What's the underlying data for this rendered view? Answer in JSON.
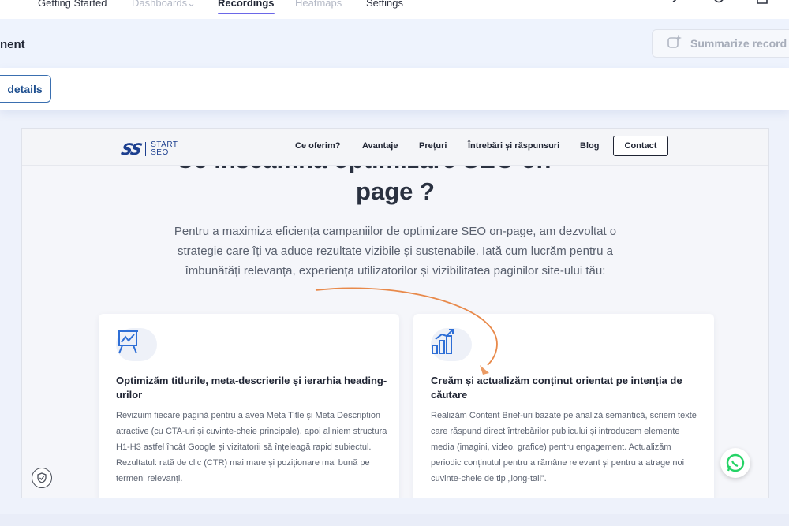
{
  "app_nav": {
    "tabs": [
      {
        "label": "Getting Started"
      },
      {
        "label": "Dashboards"
      },
      {
        "label": "Recordings"
      },
      {
        "label": "Heatmaps"
      },
      {
        "label": "Settings"
      }
    ],
    "chevron": "⌄",
    "icons": [
      "help-icon",
      "notification-icon",
      "calendar-icon"
    ]
  },
  "session": {
    "title_fragment": "nent",
    "summarize_label": "Summarize record",
    "details_label": "details"
  },
  "site": {
    "logo_mark": "SS",
    "logo_word_1": "START",
    "logo_word_2": "SEO",
    "nav": [
      "Ce oferim?",
      "Avantaje",
      "Prețuri",
      "Întrebări și răspunsuri",
      "Blog"
    ],
    "contact_label": "Contact",
    "heading_cut": "Ce înseamnă optimizare SEO on",
    "heading_line2": "page ?",
    "intro": "Pentru a maximiza eficiența campaniilor de optimizare SEO on-page, am dezvoltat o strategie care îți va aduce rezultate vizibile și sustenabile. Iată cum lucrăm pentru a îmbunătăți relevanța, experiența utilizatorilor și vizibilitatea paginilor site-ului tău:",
    "cards": [
      {
        "icon": "presentation-chart-icon",
        "title": "Optimizăm titlurile, meta-descrierile și ierarhia heading-urilor",
        "body": "Revizuim fiecare pagină pentru a avea Meta Title și Meta Description atractive (cu CTA-uri și cuvinte-cheie principale), apoi aliniem structura H1-H3 astfel încât Google și vizitatorii să înțeleagă rapid subiectul. Rezultatul: rată de clic (CTR) mai mare și poziționare mai bună pe termeni relevanți."
      },
      {
        "icon": "bar-growth-icon",
        "title": "Creăm și actualizăm conținut orientat pe intenția de căutare",
        "body": "Realizăm Content Brief-uri bazate pe analiză semantică, scriem texte care răspund direct întrebărilor publicului și introducem elemente media (imagini, video, grafice) pentru engagement. Actualizăm periodic conținutul pentru a rămâne relevant și pentru a atrage noi cuvinte-cheie de tip „long-tail”."
      }
    ]
  },
  "colors": {
    "accent": "#6b67e8",
    "brand_blue": "#1c3f8f",
    "cursor_trail": "#e8894a",
    "whatsapp": "#25d366"
  }
}
